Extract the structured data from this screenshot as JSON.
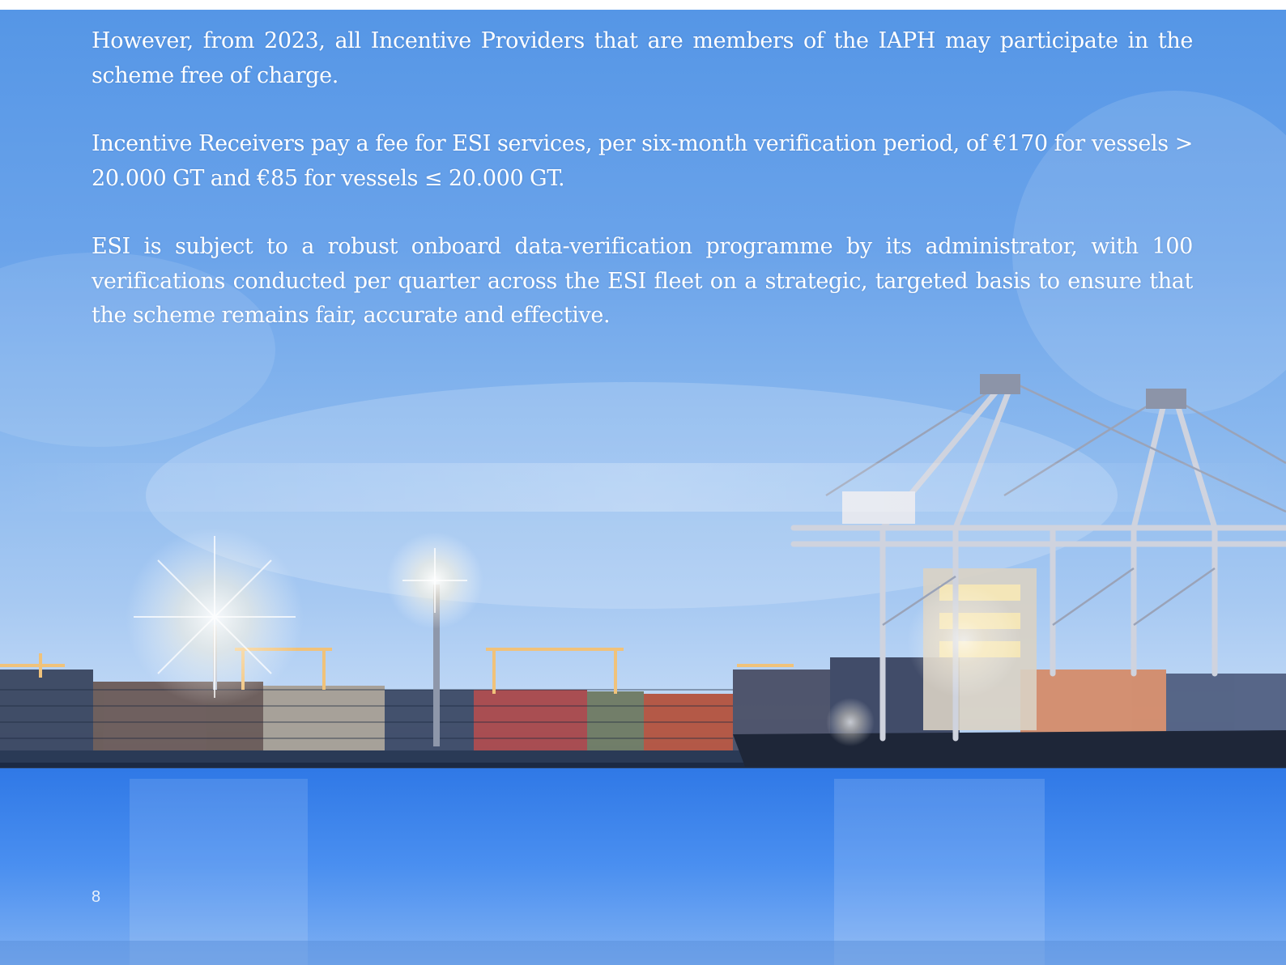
{
  "body": {
    "paragraphs": [
      "However, from 2023, all Incentive Providers that are members of the IAPH may participate in the scheme free of charge.",
      "Incentive Receivers pay a fee for ESI services, per six-month verification period, of €170 for vessels > 20.000 GT and €85 for vessels ≤ 20.000 GT.",
      "ESI is subject to a robust onboard data-verification programme by its administrator, with 100 verifications conducted per quarter across the ESI fleet on a strategic, targeted basis to ensure that the scheme remains fair, accurate and effective."
    ]
  },
  "footer": {
    "page_number": "8"
  },
  "colors": {
    "sky": "#5596e6",
    "water": "#3b82ea",
    "text": "#ffffff"
  }
}
